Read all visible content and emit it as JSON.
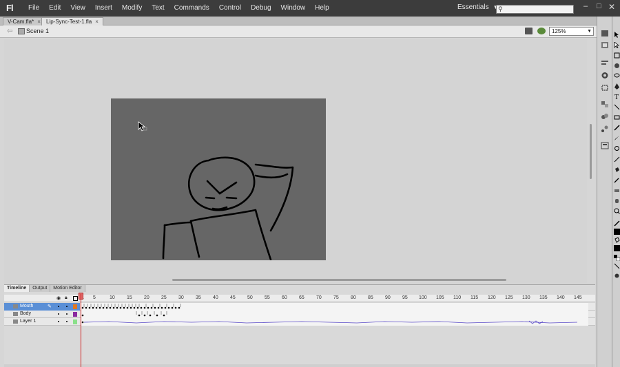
{
  "app": {
    "logo": "Fl"
  },
  "menu": [
    "File",
    "Edit",
    "View",
    "Insert",
    "Modify",
    "Text",
    "Commands",
    "Control",
    "Debug",
    "Window",
    "Help"
  ],
  "workspace": {
    "label": "Essentials"
  },
  "search": {
    "placeholder": "",
    "icon": "search-icon"
  },
  "tabs": [
    {
      "label": "V-Cam.fla*",
      "active": false
    },
    {
      "label": "Lip-Sync-Test-1.fla",
      "active": true
    }
  ],
  "editbar": {
    "scene_label": "Scene 1",
    "zoom": "125%"
  },
  "stage": {
    "background": "#666666",
    "pasteboard": "#d4d4d4"
  },
  "timeline": {
    "tabs": [
      "Timeline",
      "Output",
      "Motion Editor"
    ],
    "ruler": [
      "1",
      "5",
      "10",
      "15",
      "20",
      "25",
      "30",
      "35",
      "40",
      "45",
      "50",
      "55",
      "60",
      "65",
      "70",
      "75",
      "80",
      "85",
      "90",
      "95",
      "100",
      "105",
      "110",
      "115",
      "120",
      "125",
      "130",
      "135",
      "140",
      "145"
    ],
    "layers": [
      {
        "name": "Mouth",
        "color": "#e07820",
        "selected": true
      },
      {
        "name": "Body",
        "color": "#8a2aa0",
        "selected": false
      },
      {
        "name": "Layer 1",
        "color": "#8ae08a",
        "selected": false
      }
    ]
  },
  "colors": {
    "menubar": "#3c3c3c",
    "selection": "#5a8fd6",
    "playhead": "#d02020"
  }
}
